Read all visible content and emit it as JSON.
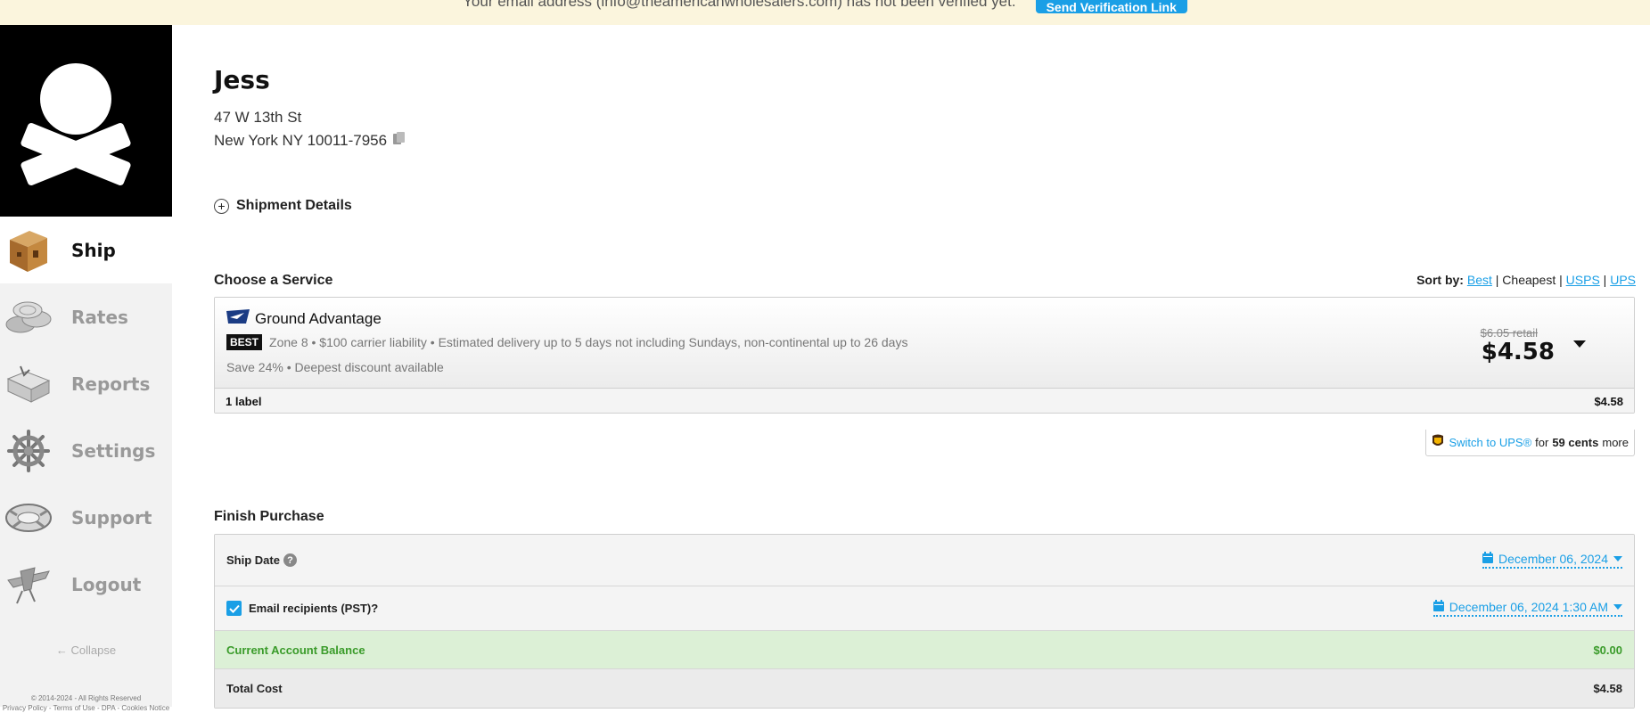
{
  "banner": {
    "message": "Your email address (info@theamericanwholesalers.com) has not been verified yet.",
    "button_label": "Send Verification Link"
  },
  "sidebar": {
    "items": [
      {
        "label": "Ship",
        "icon": "box-icon",
        "active": true
      },
      {
        "label": "Rates",
        "icon": "coins-icon",
        "active": false
      },
      {
        "label": "Reports",
        "icon": "map-icon",
        "active": false
      },
      {
        "label": "Settings",
        "icon": "ship-wheel-icon",
        "active": false
      },
      {
        "label": "Support",
        "icon": "life-ring-icon",
        "active": false
      },
      {
        "label": "Logout",
        "icon": "plane-icon",
        "active": false
      }
    ],
    "collapse_label": "Collapse",
    "copyright": "© 2014-2024 - All Rights Reserved",
    "footer_links": "Privacy Policy - Terms of Use - DPA - Cookies Notice"
  },
  "recipient": {
    "name": "Jess",
    "address_line1": "47 W 13th St",
    "address_line2": "New York NY 10011-7956"
  },
  "shipment_details_label": "Shipment Details",
  "service": {
    "section_title": "Choose a Service",
    "sort_by_label": "Sort by:",
    "sort_options": {
      "best": "Best",
      "cheapest": "Cheapest",
      "usps": "USPS",
      "ups": "UPS"
    },
    "name": "Ground Advantage",
    "badge": "BEST",
    "description": "Zone 8 • $100 carrier liability • Estimated delivery up to 5 days not including Sundays, non-continental up to 26 days",
    "savings": "Save 24% • Deepest discount available",
    "retail_price": "$6.05 retail",
    "price": "$4.58",
    "label_count": "1 label",
    "label_total": "$4.58"
  },
  "switch_ups": {
    "link": "Switch to UPS®",
    "for": "for",
    "amount": "59 cents",
    "suffix": "more"
  },
  "finish": {
    "section_title": "Finish Purchase",
    "ship_date_label": "Ship Date",
    "ship_date_value": "December 06, 2024",
    "email_label": "Email recipients (PST)?",
    "email_checked": true,
    "email_date_value": "December 06, 2024 1:30 AM",
    "balance_label": "Current Account Balance",
    "balance_value": "$0.00",
    "total_label": "Total Cost",
    "total_value": "$4.58"
  },
  "colors": {
    "accent": "#1a9fe6",
    "banner_bg": "#fbf5dd",
    "balance_green": "#3a9b2a",
    "balance_bg": "#dcf0d6"
  }
}
